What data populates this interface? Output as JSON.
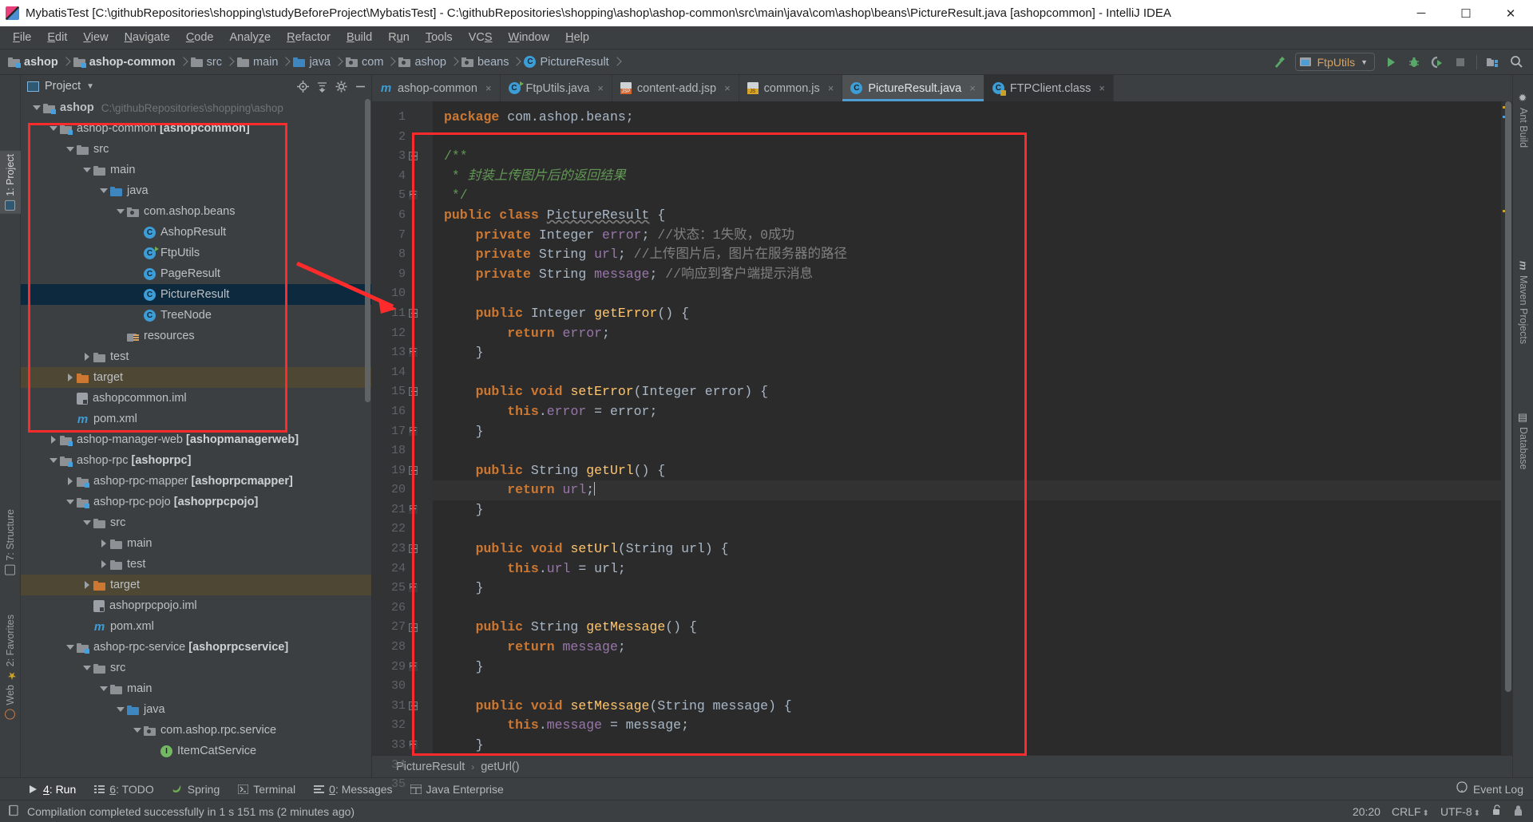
{
  "window": {
    "title": "MybatisTest [C:\\githubRepositories\\shopping\\studyBeforeProject\\MybatisTest] - C:\\githubRepositories\\shopping\\ashop\\ashop-common\\src\\main\\java\\com\\ashop\\beans\\PictureResult.java [ashopcommon] - IntelliJ IDEA",
    "minimize": "─",
    "maximize": "☐",
    "close": "✕"
  },
  "menu": {
    "items": [
      {
        "pre": "",
        "mn": "F",
        "post": "ile"
      },
      {
        "pre": "",
        "mn": "E",
        "post": "dit"
      },
      {
        "pre": "",
        "mn": "V",
        "post": "iew"
      },
      {
        "pre": "",
        "mn": "N",
        "post": "avigate"
      },
      {
        "pre": "",
        "mn": "C",
        "post": "ode"
      },
      {
        "pre": "Analy",
        "mn": "z",
        "post": "e"
      },
      {
        "pre": "",
        "mn": "R",
        "post": "efactor"
      },
      {
        "pre": "",
        "mn": "B",
        "post": "uild"
      },
      {
        "pre": "R",
        "mn": "u",
        "post": "n"
      },
      {
        "pre": "",
        "mn": "T",
        "post": "ools"
      },
      {
        "pre": "VC",
        "mn": "S",
        "post": ""
      },
      {
        "pre": "",
        "mn": "W",
        "post": "indow"
      },
      {
        "pre": "",
        "mn": "H",
        "post": "elp"
      }
    ]
  },
  "navbar": {
    "crumbs": [
      {
        "label": "ashop",
        "icon": "module-icon",
        "bold": true
      },
      {
        "label": "ashop-common",
        "icon": "module-icon",
        "bold": true
      },
      {
        "label": "src",
        "icon": "folder-icon",
        "bold": false
      },
      {
        "label": "main",
        "icon": "folder-icon",
        "bold": false
      },
      {
        "label": "java",
        "icon": "source-folder-icon",
        "bold": false
      },
      {
        "label": "com",
        "icon": "package-icon",
        "bold": false
      },
      {
        "label": "ashop",
        "icon": "package-icon",
        "bold": false
      },
      {
        "label": "beans",
        "icon": "package-icon",
        "bold": false
      },
      {
        "label": "PictureResult",
        "icon": "class-icon",
        "bold": false
      }
    ],
    "run_config": "FtpUtils",
    "actions": [
      "build-hammer-icon",
      "run-icon",
      "debug-icon",
      "run-with-coverage-icon",
      "stop-icon",
      "project-structure-icon",
      "search-icon"
    ]
  },
  "project_panel": {
    "title": "Project",
    "actions": [
      "locate-icon",
      "collapse-all-icon",
      "settings-gear-icon",
      "hide-icon"
    ],
    "tree": [
      {
        "depth": 0,
        "twist": "open",
        "icon": "module-icon",
        "label": "ashop",
        "bold": true,
        "path": "C:\\githubRepositories\\shopping\\ashop",
        "state": "none"
      },
      {
        "depth": 1,
        "twist": "open",
        "icon": "module-icon",
        "label": "ashop-common ",
        "suffix": "[ashopcommon]",
        "state": "none"
      },
      {
        "depth": 2,
        "twist": "open",
        "icon": "folder-icon",
        "label": "src",
        "state": "none"
      },
      {
        "depth": 3,
        "twist": "open",
        "icon": "folder-icon",
        "label": "main",
        "state": "none"
      },
      {
        "depth": 4,
        "twist": "open",
        "icon": "source-folder-icon",
        "label": "java",
        "state": "none"
      },
      {
        "depth": 5,
        "twist": "open",
        "icon": "package-icon",
        "label": "com.ashop.beans",
        "state": "none"
      },
      {
        "depth": 6,
        "twist": "none",
        "icon": "class-icon",
        "label": "AshopResult",
        "state": "none"
      },
      {
        "depth": 6,
        "twist": "none",
        "icon": "class-runnable-icon",
        "label": "FtpUtils",
        "state": "none"
      },
      {
        "depth": 6,
        "twist": "none",
        "icon": "class-icon",
        "label": "PageResult",
        "state": "none"
      },
      {
        "depth": 6,
        "twist": "none",
        "icon": "class-icon",
        "label": "PictureResult",
        "state": "selected"
      },
      {
        "depth": 6,
        "twist": "none",
        "icon": "class-icon",
        "label": "TreeNode",
        "state": "none"
      },
      {
        "depth": 5,
        "twist": "none",
        "icon": "resources-icon",
        "label": "resources",
        "state": "none"
      },
      {
        "depth": 3,
        "twist": "closed",
        "icon": "folder-icon",
        "label": "test",
        "state": "none"
      },
      {
        "depth": 2,
        "twist": "closed",
        "icon": "folder-orange-icon",
        "label": "target",
        "state": "highlight"
      },
      {
        "depth": 2,
        "twist": "none",
        "icon": "iml-icon",
        "label": "ashopcommon.iml",
        "state": "none"
      },
      {
        "depth": 2,
        "twist": "none",
        "icon": "maven-icon",
        "label": "pom.xml",
        "state": "none"
      },
      {
        "depth": 1,
        "twist": "closed",
        "icon": "module-icon",
        "label": "ashop-manager-web ",
        "suffix": "[ashopmanagerweb]",
        "state": "none"
      },
      {
        "depth": 1,
        "twist": "open",
        "icon": "module-icon",
        "label": "ashop-rpc ",
        "suffix": "[ashoprpc]",
        "state": "none"
      },
      {
        "depth": 2,
        "twist": "closed",
        "icon": "module-icon",
        "label": "ashop-rpc-mapper ",
        "suffix": "[ashoprpcmapper]",
        "state": "none"
      },
      {
        "depth": 2,
        "twist": "open",
        "icon": "module-icon",
        "label": "ashop-rpc-pojo ",
        "suffix": "[ashoprpcpojo]",
        "state": "none"
      },
      {
        "depth": 3,
        "twist": "open",
        "icon": "folder-icon",
        "label": "src",
        "state": "none"
      },
      {
        "depth": 4,
        "twist": "closed",
        "icon": "folder-icon",
        "label": "main",
        "state": "none"
      },
      {
        "depth": 4,
        "twist": "closed",
        "icon": "folder-icon",
        "label": "test",
        "state": "none"
      },
      {
        "depth": 3,
        "twist": "closed",
        "icon": "folder-orange-icon",
        "label": "target",
        "state": "highlight"
      },
      {
        "depth": 3,
        "twist": "none",
        "icon": "iml-icon",
        "label": "ashoprpcpojo.iml",
        "state": "none"
      },
      {
        "depth": 3,
        "twist": "none",
        "icon": "maven-icon",
        "label": "pom.xml",
        "state": "none"
      },
      {
        "depth": 2,
        "twist": "open",
        "icon": "module-icon",
        "label": "ashop-rpc-service ",
        "suffix": "[ashoprpcservice]",
        "state": "none"
      },
      {
        "depth": 3,
        "twist": "open",
        "icon": "folder-icon",
        "label": "src",
        "state": "none"
      },
      {
        "depth": 4,
        "twist": "open",
        "icon": "folder-icon",
        "label": "main",
        "state": "none"
      },
      {
        "depth": 5,
        "twist": "open",
        "icon": "source-folder-icon",
        "label": "java",
        "state": "none"
      },
      {
        "depth": 6,
        "twist": "open",
        "icon": "package-icon",
        "label": "com.ashop.rpc.service",
        "state": "none"
      },
      {
        "depth": 7,
        "twist": "none",
        "icon": "interface-icon",
        "label": "ItemCatService",
        "state": "none"
      }
    ]
  },
  "left_strip": [
    {
      "label": "1: Project",
      "selected": true
    },
    {
      "label": "7: Structure",
      "selected": false
    },
    {
      "label": "2: Favorites",
      "selected": false
    },
    {
      "label": "Web",
      "selected": false
    }
  ],
  "right_strip": [
    {
      "label": "Ant Build",
      "icon": "ant-icon"
    },
    {
      "label": "Maven Projects",
      "icon": "maven-icon"
    },
    {
      "label": "Database",
      "icon": "database-icon"
    }
  ],
  "editor": {
    "tabs": [
      {
        "label": "ashop-common",
        "icon": "maven-icon",
        "active": false,
        "dark": false
      },
      {
        "label": "FtpUtils.java",
        "icon": "class-runnable-icon",
        "active": false,
        "dark": false
      },
      {
        "label": "content-add.jsp",
        "icon": "jsp-icon",
        "active": false,
        "dark": false
      },
      {
        "label": "common.js",
        "icon": "js-icon",
        "active": false,
        "dark": false
      },
      {
        "label": "PictureResult.java",
        "icon": "class-icon",
        "active": true,
        "dark": false
      },
      {
        "label": "FTPClient.class",
        "icon": "class-file-icon",
        "active": false,
        "dark": true
      }
    ],
    "close_glyph": "×",
    "breadcrumb": [
      "PictureResult",
      "getUrl()"
    ],
    "breadcrumb_sep": "›",
    "current_line": 20,
    "lines": [
      {
        "n": 1,
        "fold": "",
        "tokens": [
          {
            "t": "package ",
            "c": "kw"
          },
          {
            "t": "com.ashop.beans;",
            "c": "typ"
          }
        ]
      },
      {
        "n": 2,
        "fold": "",
        "tokens": []
      },
      {
        "n": 3,
        "fold": "start",
        "tokens": [
          {
            "t": "/**",
            "c": "docp"
          }
        ]
      },
      {
        "n": 4,
        "fold": "",
        "tokens": [
          {
            "t": " * ",
            "c": "docp"
          },
          {
            "t": "封装上传图片后的返回结果",
            "c": "doc"
          }
        ]
      },
      {
        "n": 5,
        "fold": "end",
        "tokens": [
          {
            "t": " */",
            "c": "docp"
          }
        ]
      },
      {
        "n": 6,
        "fold": "",
        "tokens": [
          {
            "t": "public class ",
            "c": "kw"
          },
          {
            "t": "PictureResult",
            "c": "cls-warn"
          },
          {
            "t": " {",
            "c": "typ"
          }
        ]
      },
      {
        "n": 7,
        "fold": "",
        "tokens": [
          {
            "t": "    ",
            "c": "typ"
          },
          {
            "t": "private ",
            "c": "kw"
          },
          {
            "t": "Integer ",
            "c": "typ"
          },
          {
            "t": "error",
            "c": "fld"
          },
          {
            "t": "; ",
            "c": "typ"
          },
          {
            "t": "//状态：1失败，0成功",
            "c": "cmt"
          }
        ]
      },
      {
        "n": 8,
        "fold": "",
        "tokens": [
          {
            "t": "    ",
            "c": "typ"
          },
          {
            "t": "private ",
            "c": "kw"
          },
          {
            "t": "String ",
            "c": "typ"
          },
          {
            "t": "url",
            "c": "fld"
          },
          {
            "t": "; ",
            "c": "typ"
          },
          {
            "t": "//上传图片后，图片在服务器的路径",
            "c": "cmt"
          }
        ]
      },
      {
        "n": 9,
        "fold": "",
        "tokens": [
          {
            "t": "    ",
            "c": "typ"
          },
          {
            "t": "private ",
            "c": "kw"
          },
          {
            "t": "String ",
            "c": "typ"
          },
          {
            "t": "message",
            "c": "fld"
          },
          {
            "t": "; ",
            "c": "typ"
          },
          {
            "t": "//响应到客户端提示消息",
            "c": "cmt"
          }
        ]
      },
      {
        "n": 10,
        "fold": "",
        "tokens": []
      },
      {
        "n": 11,
        "fold": "start",
        "tokens": [
          {
            "t": "    ",
            "c": "typ"
          },
          {
            "t": "public ",
            "c": "kw"
          },
          {
            "t": "Integer ",
            "c": "typ"
          },
          {
            "t": "getError",
            "c": "mth"
          },
          {
            "t": "() {",
            "c": "typ"
          }
        ]
      },
      {
        "n": 12,
        "fold": "",
        "tokens": [
          {
            "t": "        ",
            "c": "typ"
          },
          {
            "t": "return ",
            "c": "kw"
          },
          {
            "t": "error",
            "c": "fld"
          },
          {
            "t": ";",
            "c": "typ"
          }
        ]
      },
      {
        "n": 13,
        "fold": "end",
        "tokens": [
          {
            "t": "    }",
            "c": "typ"
          }
        ]
      },
      {
        "n": 14,
        "fold": "",
        "tokens": []
      },
      {
        "n": 15,
        "fold": "start",
        "tokens": [
          {
            "t": "    ",
            "c": "typ"
          },
          {
            "t": "public void ",
            "c": "kw"
          },
          {
            "t": "setError",
            "c": "mth"
          },
          {
            "t": "(Integer error) {",
            "c": "typ"
          }
        ]
      },
      {
        "n": 16,
        "fold": "",
        "tokens": [
          {
            "t": "        ",
            "c": "typ"
          },
          {
            "t": "this",
            "c": "kw"
          },
          {
            "t": ".",
            "c": "typ"
          },
          {
            "t": "error",
            "c": "fld"
          },
          {
            "t": " = error;",
            "c": "typ"
          }
        ]
      },
      {
        "n": 17,
        "fold": "end",
        "tokens": [
          {
            "t": "    }",
            "c": "typ"
          }
        ]
      },
      {
        "n": 18,
        "fold": "",
        "tokens": []
      },
      {
        "n": 19,
        "fold": "start",
        "tokens": [
          {
            "t": "    ",
            "c": "typ"
          },
          {
            "t": "public ",
            "c": "kw"
          },
          {
            "t": "String ",
            "c": "typ"
          },
          {
            "t": "getUrl",
            "c": "mth"
          },
          {
            "t": "() {",
            "c": "typ"
          }
        ]
      },
      {
        "n": 20,
        "fold": "",
        "tokens": [
          {
            "t": "        ",
            "c": "typ"
          },
          {
            "t": "return ",
            "c": "kw"
          },
          {
            "t": "url",
            "c": "fld"
          },
          {
            "t": ";",
            "c": "typ"
          }
        ],
        "caret": true
      },
      {
        "n": 21,
        "fold": "end",
        "tokens": [
          {
            "t": "    }",
            "c": "typ"
          }
        ]
      },
      {
        "n": 22,
        "fold": "",
        "tokens": []
      },
      {
        "n": 23,
        "fold": "start",
        "tokens": [
          {
            "t": "    ",
            "c": "typ"
          },
          {
            "t": "public void ",
            "c": "kw"
          },
          {
            "t": "setUrl",
            "c": "mth"
          },
          {
            "t": "(String url) {",
            "c": "typ"
          }
        ]
      },
      {
        "n": 24,
        "fold": "",
        "tokens": [
          {
            "t": "        ",
            "c": "typ"
          },
          {
            "t": "this",
            "c": "kw"
          },
          {
            "t": ".",
            "c": "typ"
          },
          {
            "t": "url",
            "c": "fld"
          },
          {
            "t": " = url;",
            "c": "typ"
          }
        ]
      },
      {
        "n": 25,
        "fold": "end",
        "tokens": [
          {
            "t": "    }",
            "c": "typ"
          }
        ]
      },
      {
        "n": 26,
        "fold": "",
        "tokens": []
      },
      {
        "n": 27,
        "fold": "start",
        "tokens": [
          {
            "t": "    ",
            "c": "typ"
          },
          {
            "t": "public ",
            "c": "kw"
          },
          {
            "t": "String ",
            "c": "typ"
          },
          {
            "t": "getMessage",
            "c": "mth"
          },
          {
            "t": "() {",
            "c": "typ"
          }
        ]
      },
      {
        "n": 28,
        "fold": "",
        "tokens": [
          {
            "t": "        ",
            "c": "typ"
          },
          {
            "t": "return ",
            "c": "kw"
          },
          {
            "t": "message",
            "c": "fld"
          },
          {
            "t": ";",
            "c": "typ"
          }
        ]
      },
      {
        "n": 29,
        "fold": "end",
        "tokens": [
          {
            "t": "    }",
            "c": "typ"
          }
        ]
      },
      {
        "n": 30,
        "fold": "",
        "tokens": []
      },
      {
        "n": 31,
        "fold": "start",
        "tokens": [
          {
            "t": "    ",
            "c": "typ"
          },
          {
            "t": "public void ",
            "c": "kw"
          },
          {
            "t": "setMessage",
            "c": "mth"
          },
          {
            "t": "(String message) {",
            "c": "typ"
          }
        ]
      },
      {
        "n": 32,
        "fold": "",
        "tokens": [
          {
            "t": "        ",
            "c": "typ"
          },
          {
            "t": "this",
            "c": "kw"
          },
          {
            "t": ".",
            "c": "typ"
          },
          {
            "t": "message",
            "c": "fld"
          },
          {
            "t": " = message;",
            "c": "typ"
          }
        ]
      },
      {
        "n": 33,
        "fold": "end",
        "tokens": [
          {
            "t": "    }",
            "c": "typ"
          }
        ]
      },
      {
        "n": 34,
        "fold": "",
        "tokens": [
          {
            "t": "}",
            "c": "typ"
          }
        ]
      },
      {
        "n": 35,
        "fold": "",
        "tokens": []
      }
    ]
  },
  "bottom_toolwindows": [
    {
      "pre": "",
      "u": "4",
      "post": ": Run",
      "icon": "run-icon"
    },
    {
      "pre": "",
      "u": "6",
      "post": ": TODO",
      "icon": "todo-icon"
    },
    {
      "pre": "Spring",
      "u": "",
      "post": "",
      "icon": "spring-icon"
    },
    {
      "pre": "Terminal",
      "u": "",
      "post": "",
      "icon": "terminal-icon"
    },
    {
      "pre": "",
      "u": "0",
      "post": ": Messages",
      "icon": "messages-icon"
    },
    {
      "pre": "Java Enterprise",
      "u": "",
      "post": "",
      "icon": "java-enterprise-icon"
    }
  ],
  "event_log": "Event Log",
  "statusbar": {
    "message": "Compilation completed successfully in 1 s 151 ms (2 minutes ago)",
    "position": "20:20",
    "line_separator": "CRLF",
    "encoding": "UTF-8",
    "lock_icon": "unlocked-icon",
    "inspections_icon": "hector-icon"
  },
  "annotations": {
    "box_color": "#fd2b2b",
    "arrow_color": "#fd2b2b"
  }
}
